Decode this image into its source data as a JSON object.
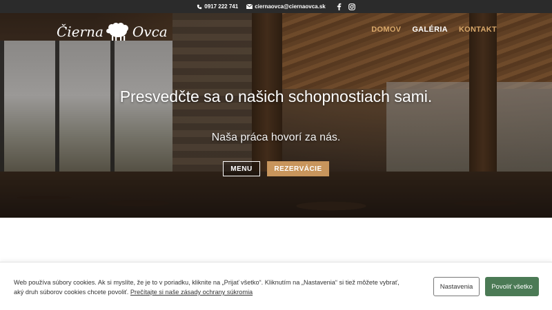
{
  "topbar": {
    "phone": "0917 222 741",
    "email": "ciernaovca@ciernaovca.sk",
    "social": [
      "facebook-icon",
      "instagram-icon"
    ]
  },
  "header": {
    "logo_text_left": "Čierna",
    "logo_text_right": "Ovca",
    "nav": [
      {
        "label": "DOMOV",
        "active": false
      },
      {
        "label": "GALÉRIA",
        "active": true
      },
      {
        "label": "KONTAKT",
        "active": false
      }
    ]
  },
  "hero": {
    "headline": "Presvedčte sa o našich schopnostiach sami.",
    "subline": "Naša práca hovorí za nás.",
    "btn_menu": "MENU",
    "btn_reservation": "REZERVÁCIE"
  },
  "cookie": {
    "text": "Web používa súbory cookies. Ak si myslíte, že je to v poriadku, kliknite na „Prijať všetko“. Kliknutím na „Nastavenia“ si tiež môžete vybrať, aký druh súborov cookies chcete povoliť.",
    "link": "Prečítajte si naše zásady ochrany súkromia",
    "btn_settings": "Nastavenia",
    "btn_allow": "Povoliť všetko"
  },
  "colors": {
    "accent": "#c8955c",
    "nav_inactive": "#d9a86a",
    "topbar_bg": "#2b2b2b",
    "allow_button": "#4b7a55"
  }
}
